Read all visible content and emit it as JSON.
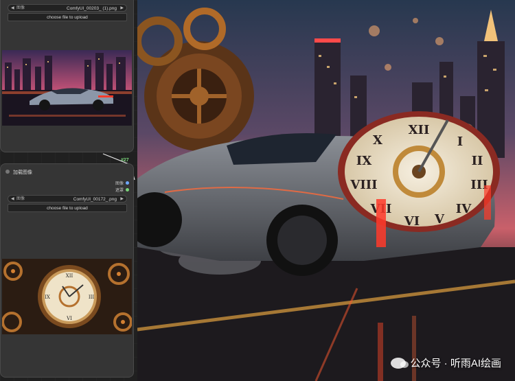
{
  "top_node": {
    "image_label": "图像",
    "image_value": "ComfyUI_00203_ (1).png",
    "upload_label": "choose file to upload",
    "arrow_left": "◀",
    "arrow_right": "▶"
  },
  "link": {
    "node_id": "#27"
  },
  "bottom_node": {
    "title": "加载图像",
    "outputs": [
      "图像",
      "遮罩"
    ],
    "image_label": "图像",
    "image_value": "ComfyUI_00172_.png",
    "upload_label": "choose file to upload",
    "arrow_left": "◀",
    "arrow_right": "▶"
  },
  "watermark": {
    "text": "公众号 · 听雨AI绘画"
  },
  "colors": {
    "output_image_dot": "#6fa8ff",
    "output_mask_dot": "#7ad47a",
    "node_bg": "#353535",
    "canvas_bg": "#202020"
  }
}
